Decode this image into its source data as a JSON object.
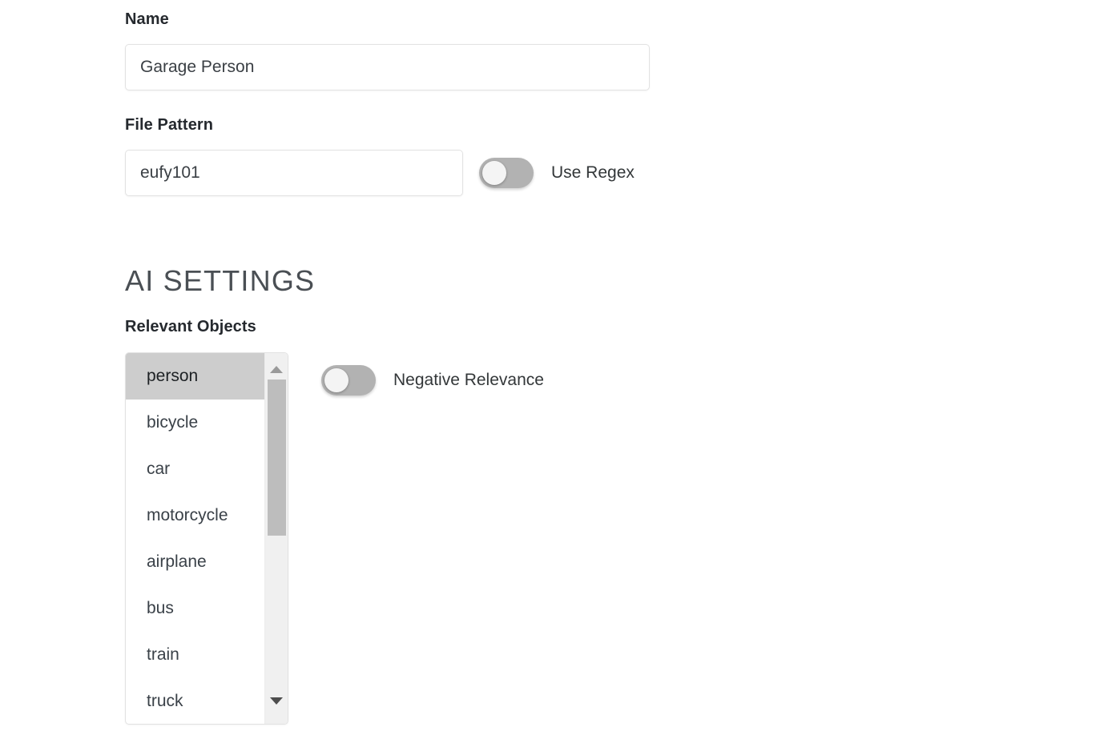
{
  "form": {
    "name": {
      "label": "Name",
      "value": "Garage Person",
      "placeholder": "Name"
    },
    "file_pattern": {
      "label": "File Pattern",
      "value": "eufy101",
      "placeholder": "File Pattern",
      "use_regex_label": "Use Regex",
      "use_regex_on": false
    }
  },
  "ai_settings": {
    "heading": "AI SETTINGS",
    "relevant_objects": {
      "label": "Relevant Objects",
      "items": [
        {
          "label": "person",
          "selected": true
        },
        {
          "label": "bicycle",
          "selected": false
        },
        {
          "label": "car",
          "selected": false
        },
        {
          "label": "motorcycle",
          "selected": false
        },
        {
          "label": "airplane",
          "selected": false
        },
        {
          "label": "bus",
          "selected": false
        },
        {
          "label": "train",
          "selected": false
        },
        {
          "label": "truck",
          "selected": false
        }
      ],
      "scrollbar": {
        "up_icon": "triangle-up-icon",
        "down_icon": "triangle-down-icon"
      }
    },
    "negative_relevance": {
      "label": "Negative Relevance",
      "on": false
    }
  },
  "colors": {
    "toggle_off_track": "#b2b2b2",
    "toggle_knob": "#f4f4f4",
    "selected_row": "#cdcdcd",
    "input_border": "#e2e2e2",
    "text": "#3a4148"
  }
}
